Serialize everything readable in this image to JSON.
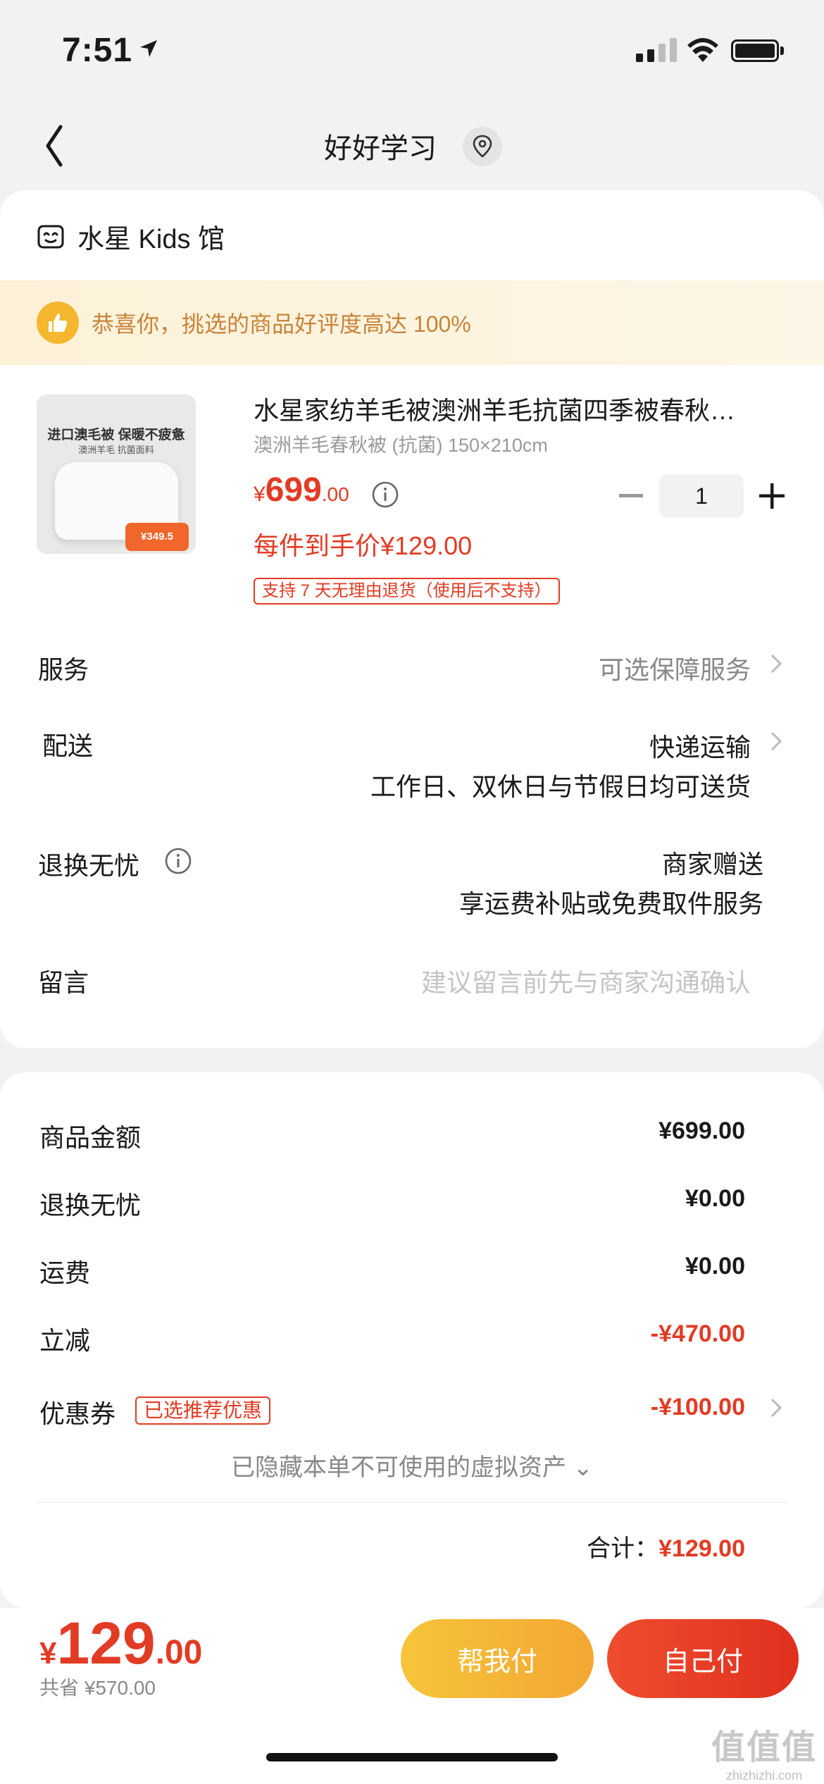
{
  "status_bar": {
    "time": "7:51"
  },
  "nav": {
    "title": "好好学习"
  },
  "shop": {
    "name": "水星 Kids 馆"
  },
  "banner": {
    "text": "恭喜你，挑选的商品好评度高达 100%"
  },
  "product": {
    "title": "水星家纺羊毛被澳洲羊毛抗菌四季被春秋…",
    "spec": "澳洲羊毛春秋被 (抗菌)  150×210cm",
    "price_yen": "¥",
    "price_int": "699",
    "price_dec": ".00",
    "quantity": "1",
    "deal_price": "每件到手价¥129.00",
    "return_policy": "支持 7 天无理由退货（使用后不支持）",
    "image_text": {
      "headline": "进口澳毛被 保暖不疲惫",
      "subline": "澳洲羊毛 抗菌面料",
      "tag_price": "¥349.5"
    }
  },
  "rows": {
    "service": {
      "label": "服务",
      "value": "可选保障服务"
    },
    "delivery": {
      "label": "配送",
      "value": "快递运输",
      "sub": "工作日、双休日与节假日均可送货"
    },
    "worry_free": {
      "label": "退换无忧",
      "value": "商家赠送",
      "sub": "享运费补贴或免费取件服务"
    },
    "note": {
      "label": "留言",
      "placeholder": "建议留言前先与商家沟通确认"
    }
  },
  "summary": {
    "goods_amount": {
      "label": "商品金额",
      "value": "¥699.00"
    },
    "worry_free": {
      "label": "退换无忧",
      "value": "¥0.00"
    },
    "shipping": {
      "label": "运费",
      "value": "¥0.00"
    },
    "discount": {
      "label": "立减",
      "value": "-¥470.00"
    },
    "coupon": {
      "label": "优惠券",
      "badge": "已选推荐优惠",
      "value": "-¥100.00"
    },
    "hidden_assets": "已隐藏本单不可使用的虚拟资产 ⌄",
    "total_label": "合计：",
    "total_value": "¥129.00"
  },
  "bottom": {
    "pay_yen": "¥",
    "pay_int": "129",
    "pay_dec": ".00",
    "saved": "共省 ¥570.00",
    "help_pay": "帮我付",
    "self_pay": "自己付"
  },
  "watermark": {
    "logo": "值值值",
    "url": "zhizhizhi.com"
  },
  "colors": {
    "accent_red": "#e23b24",
    "accent_orange": "#f3a733",
    "banner_text": "#c8843a"
  }
}
